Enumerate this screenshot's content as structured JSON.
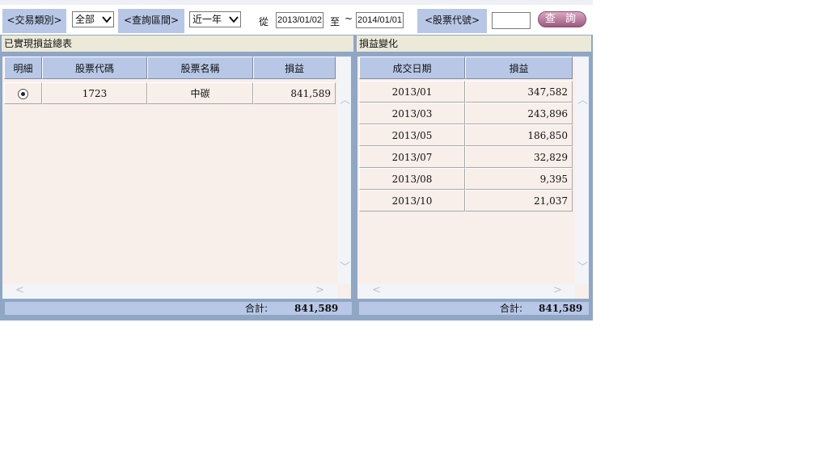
{
  "toolbar": {
    "trade_type_label": "<交易類別>",
    "trade_type_value": "全部",
    "period_label": "<查詢區間>",
    "period_value": "近一年",
    "from_label": "從",
    "from_date": "2013/01/02",
    "to_label": "至",
    "tilde": "~",
    "to_date": "2014/01/01",
    "stock_code_label": "<股票代號>",
    "stock_code_value": "",
    "query_button": "查 詢"
  },
  "summary": {
    "title": "已實現損益總表",
    "columns": [
      "明細",
      "股票代碼",
      "股票名稱",
      "損益"
    ],
    "rows": [
      {
        "code": "1723",
        "name": "中碳",
        "pl": "841,589"
      }
    ],
    "total_label": "合計:",
    "total_value": "841,589"
  },
  "changes": {
    "title": "損益變化",
    "columns": [
      "成交日期",
      "損益"
    ],
    "rows": [
      {
        "date": "2013/01",
        "pl": "347,582"
      },
      {
        "date": "2013/03",
        "pl": "243,896"
      },
      {
        "date": "2013/05",
        "pl": "186,850"
      },
      {
        "date": "2013/07",
        "pl": "32,829"
      },
      {
        "date": "2013/08",
        "pl": "9,395"
      },
      {
        "date": "2013/10",
        "pl": "21,037"
      }
    ],
    "total_label": "合計:",
    "total_value": "841,589"
  },
  "icons": {
    "dropdown": "chevron-down-icon",
    "scroll_up": "chevron-up-icon",
    "scroll_down": "chevron-down-icon",
    "scroll_left": "chevron-left-icon",
    "scroll_right": "chevron-right-icon"
  },
  "colors": {
    "header_blue": "#b8c7e6",
    "panel_frame": "#8fa7c5",
    "cell_bg": "#f8efea",
    "button": "#b07395"
  }
}
